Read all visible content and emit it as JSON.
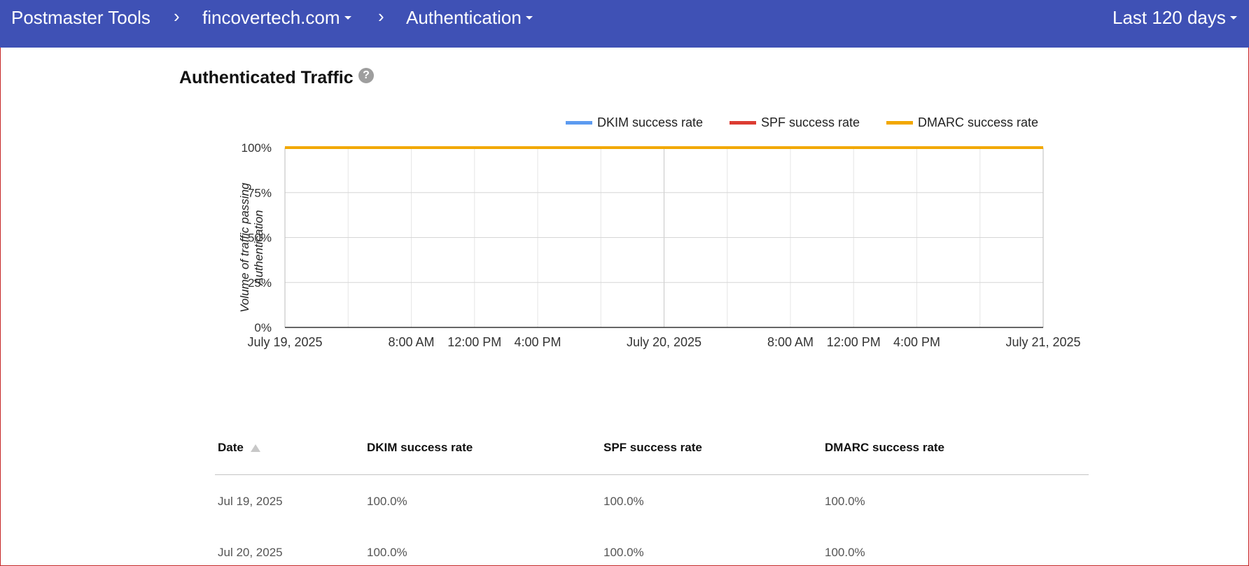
{
  "header": {
    "app_title": "Postmaster Tools",
    "domain": "fincovertech.com",
    "section": "Authentication",
    "range": "Last 120 days"
  },
  "panel": {
    "title": "Authenticated Traffic",
    "help_glyph": "?"
  },
  "chart_data": {
    "type": "line",
    "title": "",
    "xlabel": "",
    "ylabel": "Volume of traffic passing Authentication",
    "ylabel_line1": "Volume of traffic passing",
    "ylabel_line2": "Authentication",
    "x_ticks": [
      "July 19, 2025",
      "8:00 AM",
      "12:00 PM",
      "4:00 PM",
      "July 20, 2025",
      "8:00 AM",
      "12:00 PM",
      "4:00 PM",
      "July 21, 2025"
    ],
    "y_ticks": [
      "100%",
      "75%",
      "50%",
      "25%",
      "0%"
    ],
    "ylim": [
      0,
      100
    ],
    "x": [
      "2025-07-19",
      "2025-07-20",
      "2025-07-21"
    ],
    "series": [
      {
        "name": "DKIM success rate",
        "color": "#5c9bf0",
        "values": [
          100,
          100,
          100
        ]
      },
      {
        "name": "SPF success rate",
        "color": "#dc3c32",
        "values": [
          100,
          100,
          100
        ]
      },
      {
        "name": "DMARC success rate",
        "color": "#f2a800",
        "values": [
          100,
          100,
          100
        ]
      }
    ],
    "grid": true,
    "legend": "top-right"
  },
  "table": {
    "columns": [
      "Date",
      "DKIM success rate",
      "SPF success rate",
      "DMARC success rate"
    ],
    "rows": [
      [
        "Jul 19, 2025",
        "100.0%",
        "100.0%",
        "100.0%"
      ],
      [
        "Jul 20, 2025",
        "100.0%",
        "100.0%",
        "100.0%"
      ]
    ]
  }
}
